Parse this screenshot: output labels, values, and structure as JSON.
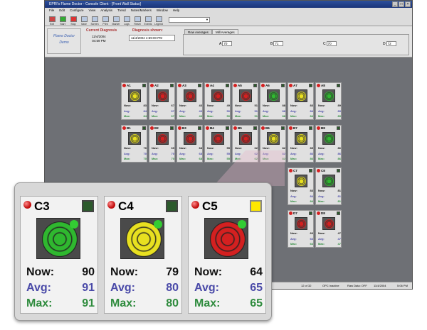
{
  "window": {
    "title": "EPRI's Flame Doctor - Console Client - [Front Wall Status]",
    "buttons": [
      "_",
      "□",
      "×"
    ]
  },
  "menu": [
    "File",
    "Edit",
    "Configure",
    "View",
    "Analysis",
    "Trend",
    "Notes/Markers",
    "Window",
    "Help"
  ],
  "toolbar": [
    {
      "label": "Exit",
      "icon": "exit-icon"
    },
    {
      "label": "Start",
      "icon": "start-icon"
    },
    {
      "label": "Stop",
      "icon": "stop-icon"
    },
    {
      "label": "Save",
      "icon": "save-icon"
    },
    {
      "label": "Screen",
      "icon": "screen-icon"
    },
    {
      "label": "Print",
      "icon": "print-icon"
    },
    {
      "label": "Marker",
      "icon": "marker-icon"
    },
    {
      "label": "Logs",
      "icon": "logs-icon"
    },
    {
      "label": "Reset",
      "icon": "reset-icon"
    },
    {
      "label": "Events",
      "icon": "events-icon"
    },
    {
      "label": "Legend",
      "icon": "legend-icon"
    }
  ],
  "header": {
    "app_line1": "Flame Doctor",
    "app_line2": "Demo",
    "current_diag_label": "Current Diagnosis",
    "current_date": "11/4/2004",
    "current_time": "04:59 PM",
    "diag_shown_label": "Diagnosis shown:",
    "diag_shown_value": "11/4/2004 4:59:00 PM",
    "tabs": [
      "Row Averages",
      "Mill Averages"
    ],
    "averages": [
      {
        "label": "A",
        "value": "70"
      },
      {
        "label": "B",
        "value": "71"
      },
      {
        "label": "C",
        "value": "70"
      },
      {
        "label": "D",
        "value": "72"
      }
    ]
  },
  "tiles": [
    [
      {
        "name": "A1",
        "now": "83",
        "avg": "84",
        "max": "84",
        "c": "y"
      },
      {
        "name": "A2",
        "now": "67",
        "avg": "67",
        "max": "67",
        "c": "r"
      },
      {
        "name": "A3",
        "now": "43",
        "avg": "43",
        "max": "43",
        "c": "r"
      },
      {
        "name": "A4",
        "now": "49",
        "avg": "50",
        "max": "50",
        "c": "r"
      },
      {
        "name": "A5",
        "now": "51",
        "avg": "51",
        "max": "51",
        "c": "r"
      },
      {
        "name": "A6",
        "now": "88",
        "avg": "88",
        "max": "88",
        "c": "g"
      },
      {
        "name": "A7",
        "now": "83",
        "avg": "84",
        "max": "84",
        "c": "y"
      },
      {
        "name": "A8",
        "now": "89",
        "avg": "89",
        "max": "89",
        "c": "g"
      }
    ],
    [
      {
        "name": "B1",
        "now": "70",
        "avg": "70",
        "max": "70",
        "c": "y"
      },
      {
        "name": "B2",
        "now": "69",
        "avg": "70",
        "max": "70",
        "c": "r"
      },
      {
        "name": "B3",
        "now": "68",
        "avg": "68",
        "max": "68",
        "c": "r"
      },
      {
        "name": "B4",
        "now": "55",
        "avg": "55",
        "max": "55",
        "c": "r"
      },
      {
        "name": "B5",
        "now": "62",
        "avg": "62",
        "max": "62",
        "c": "r"
      },
      {
        "name": "B6",
        "now": "82",
        "avg": "82",
        "max": "82",
        "c": "y"
      },
      {
        "name": "B7",
        "now": "85",
        "avg": "86",
        "max": "86",
        "c": "y"
      },
      {
        "name": "B8",
        "now": "86",
        "avg": "86",
        "max": "86",
        "c": "g"
      }
    ],
    [
      {
        "name": "C7",
        "now": "83",
        "avg": "84",
        "max": "84",
        "c": "y"
      },
      {
        "name": "C8",
        "now": "81",
        "avg": "81",
        "max": "81",
        "c": "g"
      }
    ],
    [
      {
        "name": "D7",
        "now": "66",
        "avg": "66",
        "max": "66",
        "c": "r"
      },
      {
        "name": "D8",
        "now": "47",
        "avg": "47",
        "max": "47",
        "c": "r"
      }
    ]
  ],
  "status": {
    "page": "12 of 32",
    "opc": "OPC Inactive",
    "raw": "Raw Data: OFF",
    "date": "11/4/2004",
    "time": "5:06 PM"
  },
  "zoom": [
    {
      "name": "C3",
      "now_label": "Now:",
      "now": "90",
      "avg_label": "Avg:",
      "avg": "91",
      "max_label": "Max:",
      "max": "91",
      "color": "#2fb82f",
      "square": "dark"
    },
    {
      "name": "C4",
      "now_label": "Now:",
      "now": "79",
      "avg_label": "Avg:",
      "avg": "80",
      "max_label": "Max:",
      "max": "80",
      "color": "#e8e020",
      "square": "dark"
    },
    {
      "name": "C5",
      "now_label": "Now:",
      "now": "64",
      "avg_label": "Avg:",
      "avg": "65",
      "max_label": "Max:",
      "max": "65",
      "color": "#d42020",
      "square": "yellow"
    }
  ],
  "colors": {
    "green": "#2fb82f",
    "yellow": "#e8e020",
    "red": "#d42020",
    "now": "#111111",
    "avg": "#4a4aa8",
    "max": "#2e8b3d"
  }
}
